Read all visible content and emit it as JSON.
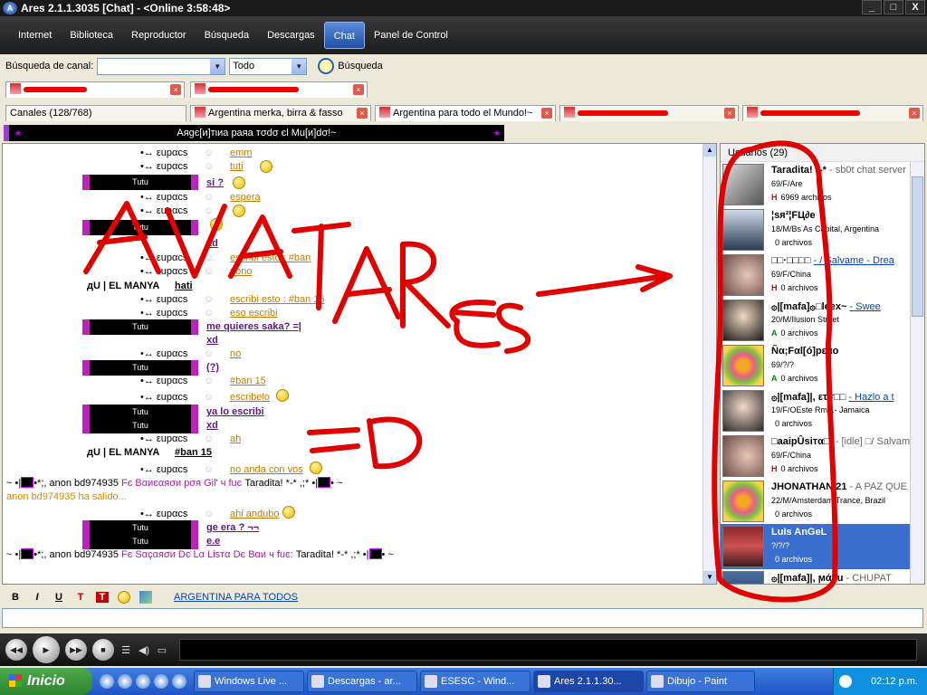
{
  "window": {
    "title": "Ares 2.1.1.3035   [Chat]  -  <Online 3:58:48>",
    "min": "_",
    "max": "□",
    "close": "X"
  },
  "menu": [
    "Internet",
    "Biblioteca",
    "Reproductor",
    "Búsqueda",
    "Descargas",
    "Chat",
    "Panel de Control"
  ],
  "search": {
    "label": "Búsqueda de canal:",
    "channel_value": "",
    "filter_value": "Todo",
    "button": "Búsqueda"
  },
  "tabs_top": [
    {
      "label": ""
    },
    {
      "label": ""
    }
  ],
  "tabs": [
    {
      "label": "Canales (128/768)"
    },
    {
      "label": "Argentina merka, birra & fasso"
    },
    {
      "label": "Argentina para todo el Mundo!~"
    },
    {
      "label": ""
    },
    {
      "label": ""
    }
  ],
  "channel": {
    "banner": "Aяgє[и]тιиa paяa тσdσ єl Mu[и]dσ!~"
  },
  "chat": {
    "nick": "•↔ εupαcs",
    "tutu": "Tutu",
    "manya_a": "дU | EL MANYA",
    "manya_b": "дU | EL MANYA",
    "manya_ban": "#ban 15",
    "m_emm": "emm",
    "m_tuti": "tuti",
    "m_si": "si ?",
    "m_espera": "espera",
    "m_xd1": "xd",
    "m_escribi": "escribi esto : #ban",
    "m_nono": "nono",
    "m_hati": "hati",
    "m_escribi15": "escribi esto : #ban 15",
    "m_esoescribi": "eso escribi",
    "m_quieres": "me quieres saka? =|",
    "m_xd2": "xd",
    "m_no": "no",
    "m_q": "(?)",
    "m_ban15": "#ban 15",
    "m_escribelo": "escribelo",
    "m_yalo": "ya lo escribi",
    "m_xd3": "xd",
    "m_ah": "ah",
    "m_noanda": "no anda con vos",
    "sys1_pre": "~ •|",
    "sys1_mid": "•*;, anon bd974935",
    "sys1_action": "Fє Bαиєαяσи pσя Gil' ч fuє",
    "sys1_target": "Taradita! *-*",
    "sys1_suf": ",;* •|",
    "sys1_end": "• ~",
    "left": "anon bd974935 ha salido...",
    "m_ahiandubo": "ahi andubo",
    "m_geera": "ge era ? ¬¬",
    "m_ee": "e.e",
    "sys2_pre": "~ •|",
    "sys2_mid": "•*;, anon bd974935",
    "sys2_action": "Fє Sαçαяσи Dє Lα Lisтα Dє Bαи ч fuє:",
    "sys2_target": "Taradita! *-*",
    "sys2_suf": ",;* •|",
    "sys2_end": "• ~"
  },
  "users": {
    "header": "Usuarios (29)",
    "list": [
      {
        "name": "Taradita! *-*",
        "extra": "- sb0t chat server",
        "detail": "69/F/Are",
        "flag": "H",
        "files": "6969 archivos",
        "flag_color": "#d00000"
      },
      {
        "name": "¦sя²¦FЦ∂e",
        "extra": "",
        "detail": "18/M/Bs As Capital, Argentina",
        "flag": "",
        "files": "0 archivos",
        "flag_color": "#000000"
      },
      {
        "name": "□□·□□□□",
        "extra": "- / Salvame - Drea",
        "detail": "69/F/China",
        "flag": "H",
        "files": "0 archivos",
        "flag_color": "#d00000"
      },
      {
        "name": "۞|[mafa]۞□leex~",
        "extra": "- Swee",
        "detail": "20/M/Ilusion Street",
        "flag": "A",
        "files": "0 archivos",
        "flag_color": "#008000"
      },
      {
        "name": "Ñα;Fαl[ó]pεαo",
        "extra": "",
        "detail": "69/?/?",
        "flag": "A",
        "files": "0 archivos",
        "flag_color": "#008000"
      },
      {
        "name": "۞|[mafa]|, ετσ□□",
        "extra": "- Hazlo a t",
        "detail": "19/F/OEste Rm...- Jamaica",
        "flag": "",
        "files": "0 archivos",
        "flag_color": "#000000"
      },
      {
        "name": "□aaipÛsiтα□|",
        "extra": "- [idle] □/ Salvam",
        "detail": "69/F/China",
        "flag": "H",
        "files": "0 archivos",
        "flag_color": "#d00000"
      },
      {
        "name": "JHONATHAN 21",
        "extra": "- A PAZ QUE T",
        "detail": "22/M/Amsterdam Trance, Brazil",
        "flag": "",
        "files": "0 archivos",
        "flag_color": "#000000"
      },
      {
        "name": "LuIs AnGeL",
        "extra": "",
        "detail": "?/?/?",
        "flag": "",
        "files": "0 archivos",
        "flag_color": "#ffffff"
      },
      {
        "name": "۞|[mafa]|, ϻάsu",
        "extra": "- CHUPAT",
        "detail": "",
        "flag": "",
        "files": "",
        "flag_color": "#000000"
      }
    ]
  },
  "format": {
    "bold": "B",
    "italic": "I",
    "underline": "U",
    "color1": "T",
    "color2": "T",
    "link": "ARGENTINA PARA TODOS"
  },
  "input": {
    "value": ""
  },
  "taskbar": {
    "start": "Inicio",
    "buttons": [
      "Windows Live ...",
      "Descargas - ar...",
      "ESESC - Wind...",
      "Ares 2.1.1.30...",
      "Dibujo - Paint"
    ],
    "clock": "02:12 p.m."
  },
  "annotation": {
    "text1": "AVATARES",
    "text2": "=D",
    "color": "#e00000"
  }
}
